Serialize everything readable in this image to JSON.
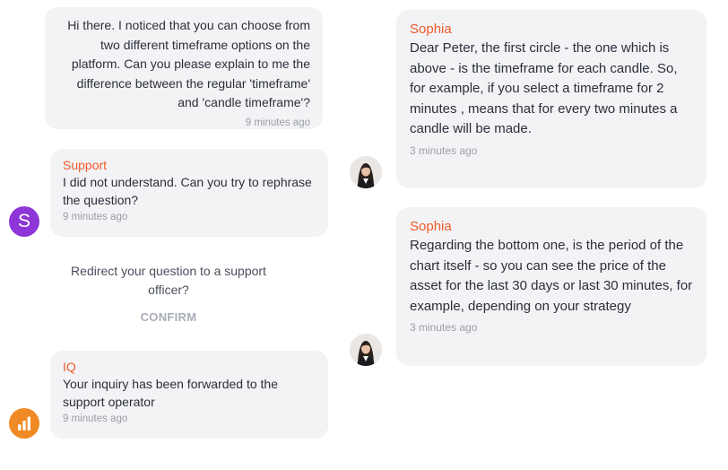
{
  "messages": {
    "user": {
      "text": "Hi there. I noticed that you can choose from two different timeframe options on the platform. Can you please explain to me the difference between the regular 'timeframe' and 'candle timeframe'?",
      "time": "9 minutes ago"
    },
    "support": {
      "sender": "Support",
      "text": "I did not understand. Can you try to rephrase the question?",
      "time": "9 minutes ago",
      "avatar_letter": "S",
      "avatar_color": "#8e35d7"
    },
    "redirect": {
      "text": "Redirect your question to a support officer?",
      "confirm_label": "CONFIRM"
    },
    "iq": {
      "sender": "IQ",
      "text": "Your inquiry has been forwarded to the support operator",
      "time": "9 minutes ago",
      "avatar_color": "#f08a24"
    },
    "sophia1": {
      "sender": "Sophia",
      "text": "Dear Peter, the first circle - the one which is above - is the timeframe for each candle. So, for example, if you select a timeframe for 2 minutes , means that for every two minutes a candle will be made.",
      "time": "3 minutes ago"
    },
    "sophia2": {
      "sender": "Sophia",
      "text": "Regarding the bottom one, is the period of the chart itself - so you can see the price of the asset for the last 30 days or last 30 minutes, for example, depending on your strategy",
      "time": "3 minutes ago"
    }
  },
  "colors": {
    "sender": "#ef5a28",
    "bubble": "#f3f3f6",
    "time": "#9a9ea8"
  }
}
